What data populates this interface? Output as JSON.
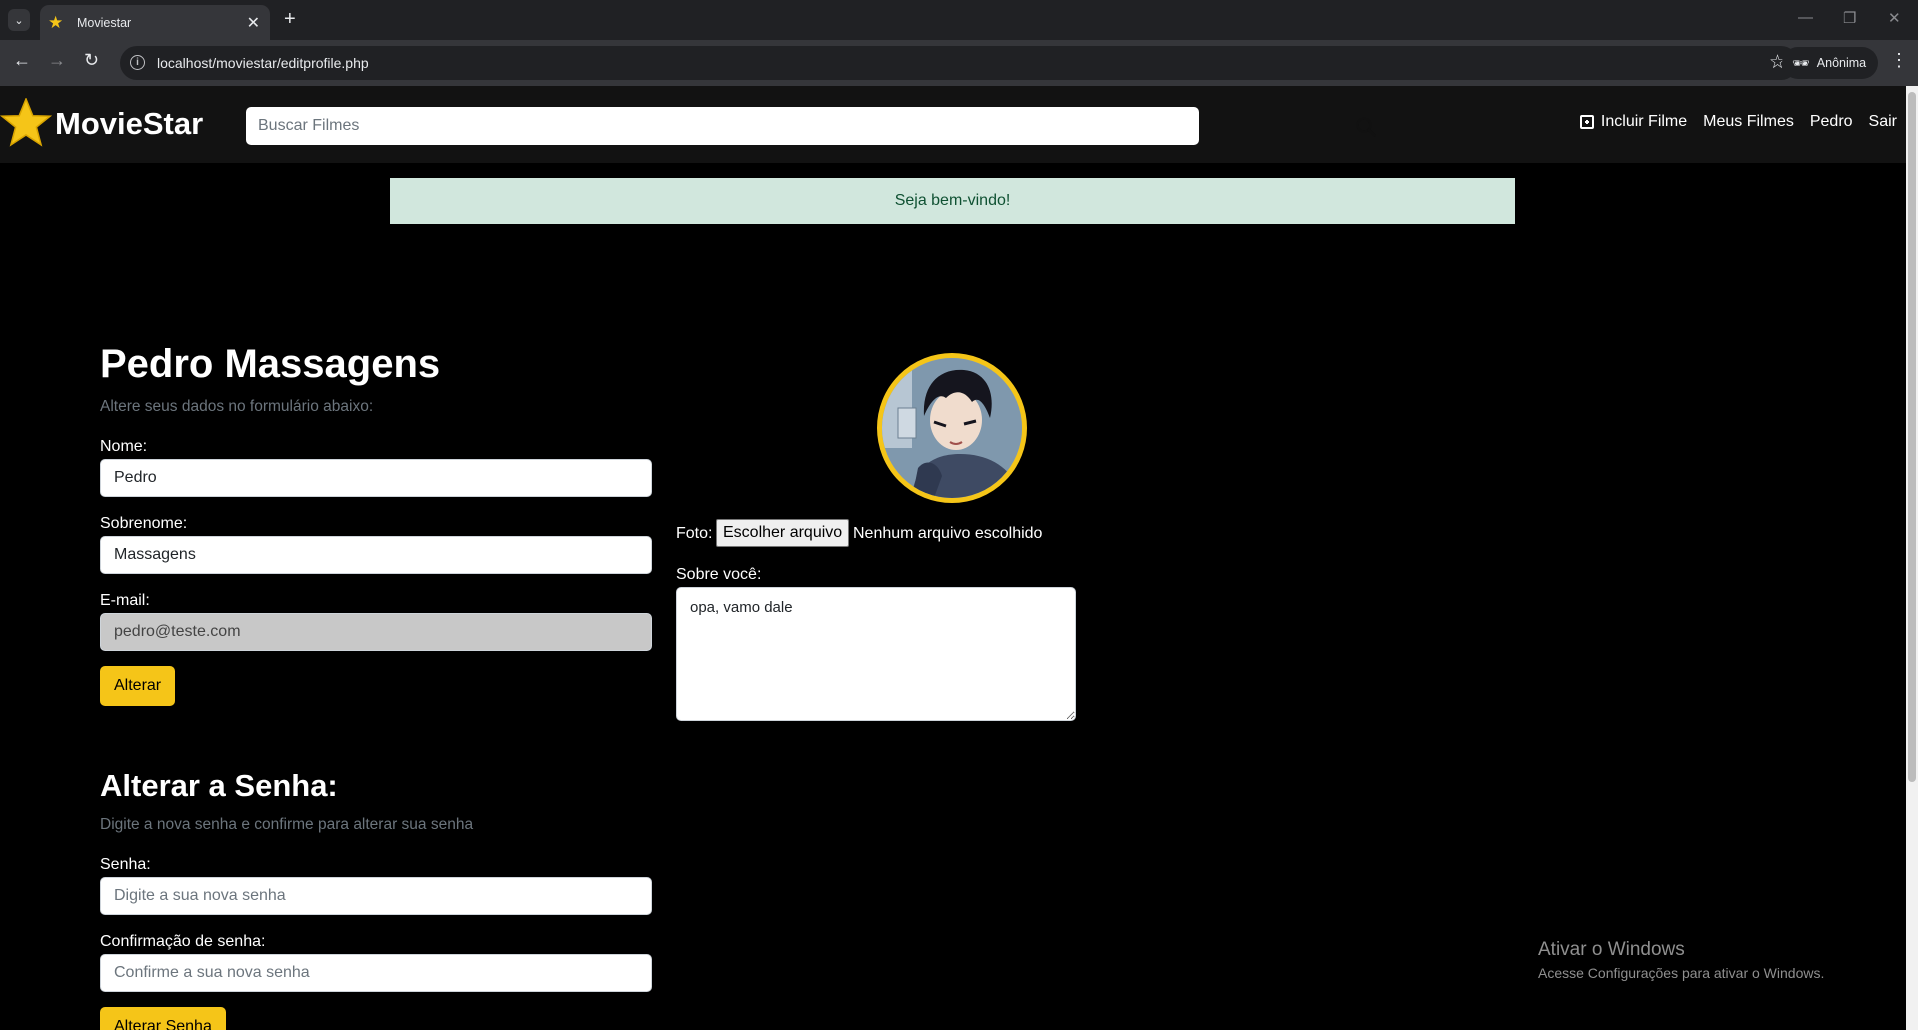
{
  "browser": {
    "tab_title": "Moviestar",
    "url": "localhost/moviestar/editprofile.php",
    "profile_label": "Anônima"
  },
  "header": {
    "brand": "MovieStar",
    "search_placeholder": "Buscar Filmes",
    "nav": {
      "add_movie": "Incluir Filme",
      "my_movies": "Meus Filmes",
      "user": "Pedro",
      "logout": "Sair"
    }
  },
  "alert": {
    "message": "Seja bem-vindo!"
  },
  "profile": {
    "full_name": "Pedro Massagens",
    "subtitle": "Altere seus dados no formulário abaixo:",
    "name_label": "Nome:",
    "name_value": "Pedro",
    "lastname_label": "Sobrenome:",
    "lastname_value": "Massagens",
    "email_label": "E-mail:",
    "email_value": "pedro@teste.com",
    "submit_label": "Alterar",
    "photo_label": "Foto:",
    "file_button": "Escolher arquivo",
    "file_status": "Nenhum arquivo escolhido",
    "about_label": "Sobre você:",
    "about_value": "opa, vamo dale"
  },
  "password": {
    "title": "Alterar a Senha:",
    "subtitle": "Digite a nova senha e confirme para alterar sua senha",
    "password_label": "Senha:",
    "password_placeholder": "Digite a sua nova senha",
    "confirm_label": "Confirmação de senha:",
    "confirm_placeholder": "Confirme a sua nova senha",
    "submit_label": "Alterar Senha"
  },
  "watermark": {
    "title": "Ativar o Windows",
    "subtitle": "Acesse Configurações para ativar o Windows."
  },
  "colors": {
    "accent": "#f5c518",
    "header_bg": "#121212",
    "page_bg": "#000000",
    "alert_bg": "#d1e7dd",
    "alert_text": "#0f5132"
  }
}
